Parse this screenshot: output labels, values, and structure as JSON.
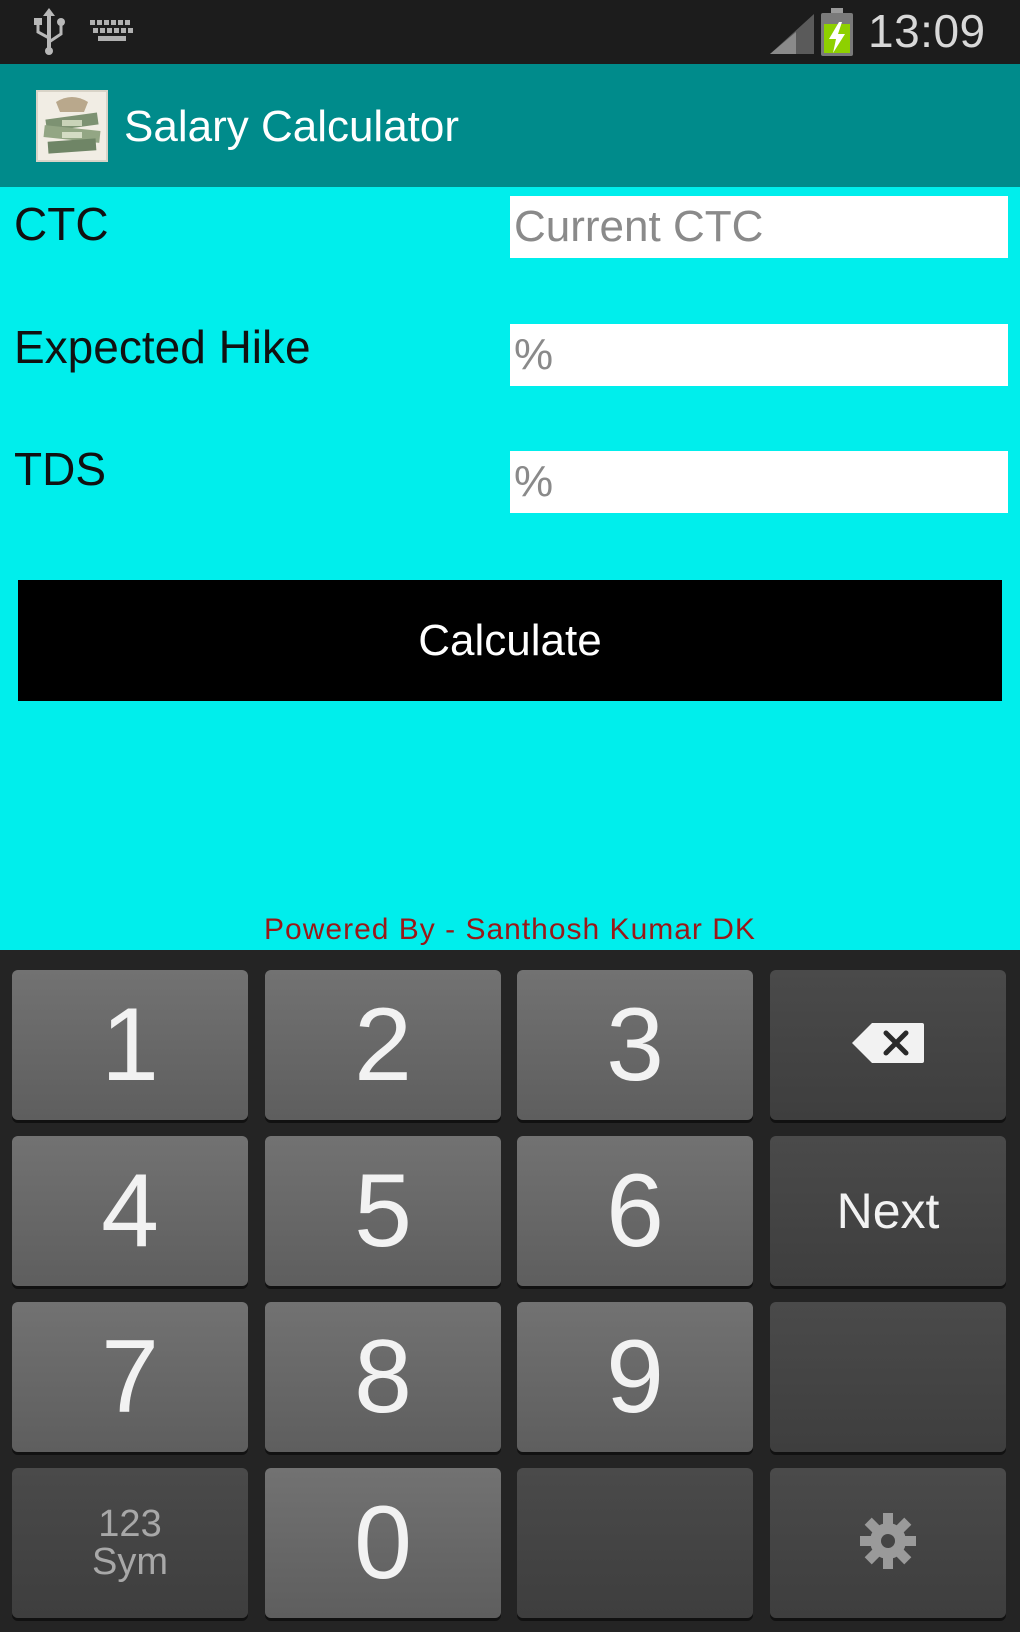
{
  "status_bar": {
    "time": "13:09",
    "icons": [
      "usb-icon",
      "keyboard-icon",
      "signal-icon",
      "battery-charging-icon"
    ]
  },
  "app_bar": {
    "title": "Salary Calculator",
    "icon": "money-stack-icon"
  },
  "form": {
    "ctc_label": "CTC",
    "ctc_placeholder": "Current CTC",
    "hike_label": "Expected Hike",
    "hike_placeholder": "%",
    "tds_label": "TDS",
    "tds_placeholder": "%",
    "calculate_label": "Calculate"
  },
  "footer": {
    "powered_by": "Powered By - Santhosh Kumar DK"
  },
  "keyboard": {
    "keys": {
      "k1": "1",
      "k2": "2",
      "k3": "3",
      "k4": "4",
      "k5": "5",
      "k6": "6",
      "k7": "7",
      "k8": "8",
      "k9": "9",
      "k0": "0"
    },
    "next_label": "Next",
    "sym_line1": "123",
    "sym_line2": "Sym",
    "icons": [
      "backspace-icon",
      "settings-gear-icon"
    ]
  },
  "colors": {
    "status_bar": "#1c1c1c",
    "app_bar": "#008b8b",
    "content_bg": "#00eeec",
    "button_bg": "#000000",
    "powered_text": "#9a1818",
    "keyboard_bg": "#242424"
  }
}
